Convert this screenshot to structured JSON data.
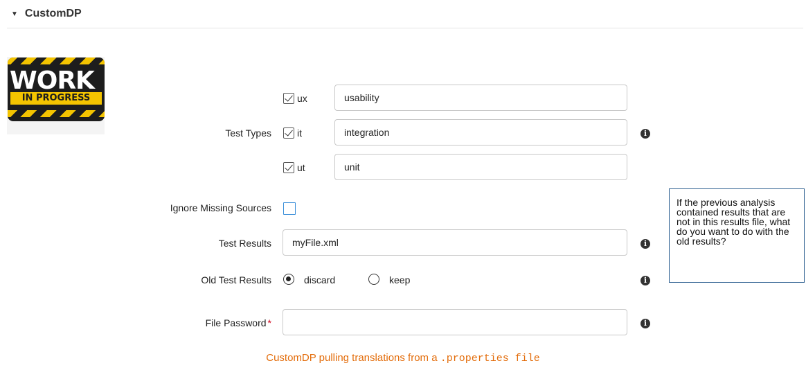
{
  "section": {
    "title": "CustomDP",
    "caret": "▼"
  },
  "logo": {
    "line1": "WORK",
    "line2": "IN PROGRESS"
  },
  "test_types": {
    "label": "Test Types",
    "items": [
      {
        "key": "ux",
        "checked": true,
        "value": "usability"
      },
      {
        "key": "it",
        "checked": true,
        "value": "integration"
      },
      {
        "key": "ut",
        "checked": true,
        "value": "unit"
      }
    ]
  },
  "ignore_missing_sources": {
    "label": "Ignore Missing Sources",
    "checked": false
  },
  "test_results": {
    "label": "Test Results",
    "value": "myFile.xml"
  },
  "old_test_results": {
    "label": "Old Test Results",
    "options": [
      "discard",
      "keep"
    ],
    "selected": "discard"
  },
  "file_password": {
    "label": "File Password",
    "required_mark": "*",
    "value": ""
  },
  "tooltip": {
    "text": "If the previous analysis contained results that are not in this results file, what do you want to do with the old results?"
  },
  "caption": {
    "text": "CustomDP pulling translations from a ",
    "code": ".properties file"
  },
  "icons": {
    "info": "info-icon",
    "caret": "caret-down-icon"
  },
  "colors": {
    "caption": "#e36c0a",
    "tooltip_border": "#2a5d8f",
    "required": "#d0021b",
    "unchecked_box": "#3b8fd9"
  }
}
